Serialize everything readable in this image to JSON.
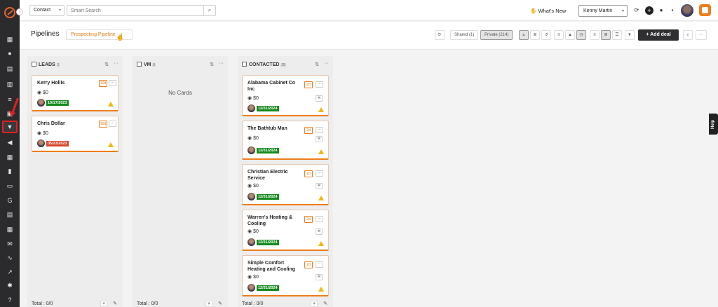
{
  "topbar": {
    "contact_select": "Contact",
    "search_placeholder": "Smart Search",
    "whats_new": "What's New",
    "user_select": "Kenny Martin"
  },
  "header": {
    "title": "Pipelines",
    "pipeline_select": "Prospecting Pipeline",
    "shared_label": "Shared (1)",
    "private_label": "Private (214)",
    "add_deal_label": "Add deal"
  },
  "help_label": "Help",
  "columns": [
    {
      "name": "LEADS",
      "count": "2",
      "total": "Total : 0/0",
      "cards": [
        {
          "title": "Kerry Hollis",
          "amount": "$0",
          "days": "10d",
          "date": "10/17/2023",
          "date_color": "#148a1e"
        },
        {
          "title": "Chris Dollar",
          "amount": "$0",
          "days": "10d",
          "date": "05/23/2023",
          "date_color": "#d9462b"
        }
      ]
    },
    {
      "name": "VM",
      "count": "0",
      "total": "Total : 0/0",
      "empty_text": "No Cards",
      "cards": []
    },
    {
      "name": "CONTACTED",
      "count": "29",
      "total": "Total : 0/0",
      "cards": [
        {
          "title": "Alabama Cabinet Co Inc",
          "amount": "$0",
          "days": "2d",
          "date": "12/31/2024",
          "date_color": "#148a1e"
        },
        {
          "title": "The Bathtub Man",
          "amount": "$0",
          "days": "2d",
          "date": "12/31/2024",
          "date_color": "#148a1e"
        },
        {
          "title": "Christian Electric Service",
          "amount": "$0",
          "days": "2d",
          "date": "12/31/2024",
          "date_color": "#148a1e"
        },
        {
          "title": "Warren's Heating & Cooling",
          "amount": "$0",
          "days": "2d",
          "date": "12/31/2024",
          "date_color": "#148a1e"
        },
        {
          "title": "Simple Comfort Heating and Cooling",
          "amount": "$0",
          "days": "2d",
          "date": "12/31/2024",
          "date_color": "#148a1e"
        }
      ]
    }
  ]
}
